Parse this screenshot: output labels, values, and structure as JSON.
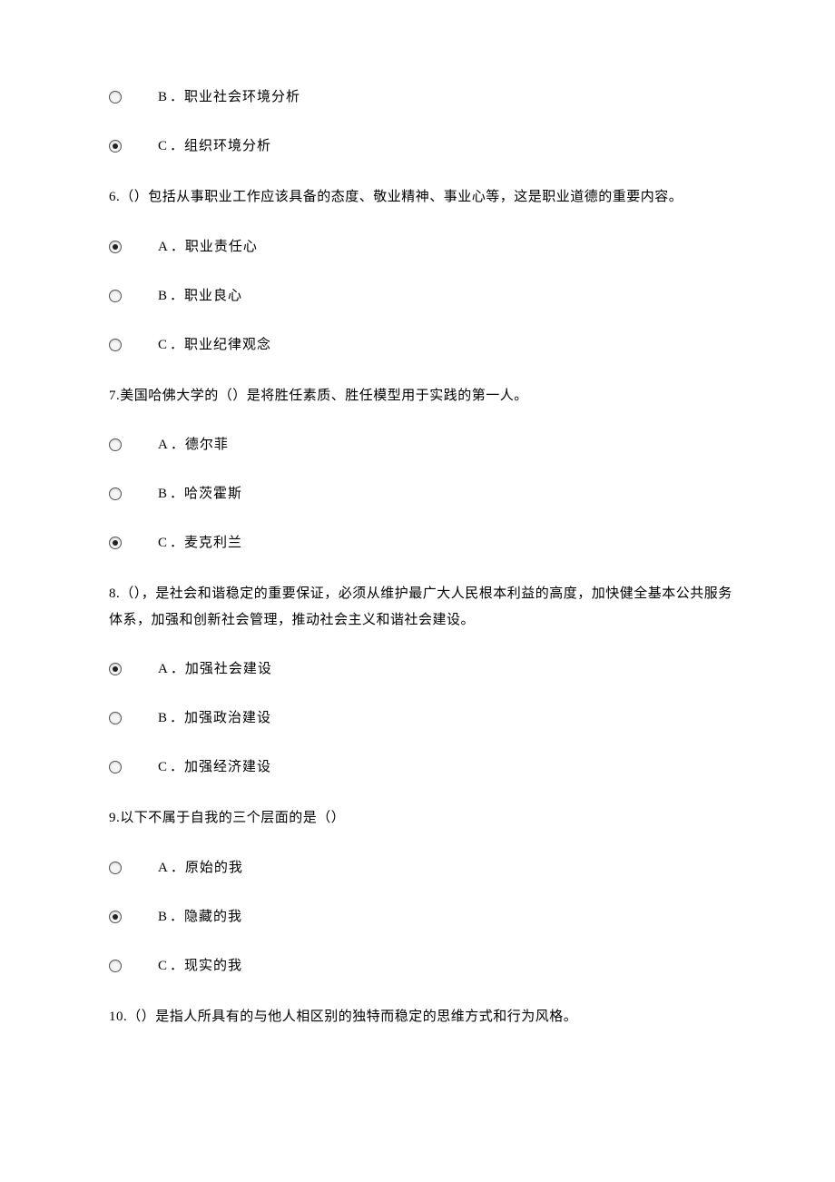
{
  "q5": {
    "options": [
      {
        "letter": "B",
        "text": "职业社会环境分析",
        "checked": false
      },
      {
        "letter": "C",
        "text": "组织环境分析",
        "checked": true
      }
    ]
  },
  "q6": {
    "number": "6.",
    "stem": "（）包括从事职业工作应该具备的态度、敬业精神、事业心等，这是职业道德的重要内容。",
    "options": [
      {
        "letter": "A",
        "text": "职业责任心",
        "checked": true
      },
      {
        "letter": "B",
        "text": "职业良心",
        "checked": false
      },
      {
        "letter": "C",
        "text": "职业纪律观念",
        "checked": false
      }
    ]
  },
  "q7": {
    "number": "7.",
    "stem": "美国哈佛大学的（）是将胜任素质、胜任模型用于实践的第一人。",
    "options": [
      {
        "letter": "A",
        "text": "德尔菲",
        "checked": false
      },
      {
        "letter": "B",
        "text": "哈茨霍斯",
        "checked": false
      },
      {
        "letter": "C",
        "text": "麦克利兰",
        "checked": true
      }
    ]
  },
  "q8": {
    "number": "8.",
    "stem": "（），是社会和谐稳定的重要保证，必须从维护最广大人民根本利益的高度，加快健全基本公共服务体系，加强和创新社会管理，推动社会主义和谐社会建设。",
    "options": [
      {
        "letter": "A",
        "text": "加强社会建设",
        "checked": true
      },
      {
        "letter": "B",
        "text": "加强政治建设",
        "checked": false
      },
      {
        "letter": "C",
        "text": "加强经济建设",
        "checked": false
      }
    ]
  },
  "q9": {
    "number": "9.",
    "stem": "以下不属于自我的三个层面的是（）",
    "options": [
      {
        "letter": "A",
        "text": "原始的我",
        "checked": false
      },
      {
        "letter": "B",
        "text": "隐藏的我",
        "checked": true
      },
      {
        "letter": "C",
        "text": "现实的我",
        "checked": false
      }
    ]
  },
  "q10": {
    "number": "10.",
    "stem": "（）是指人所具有的与他人相区别的独特而稳定的思维方式和行为风格。"
  }
}
